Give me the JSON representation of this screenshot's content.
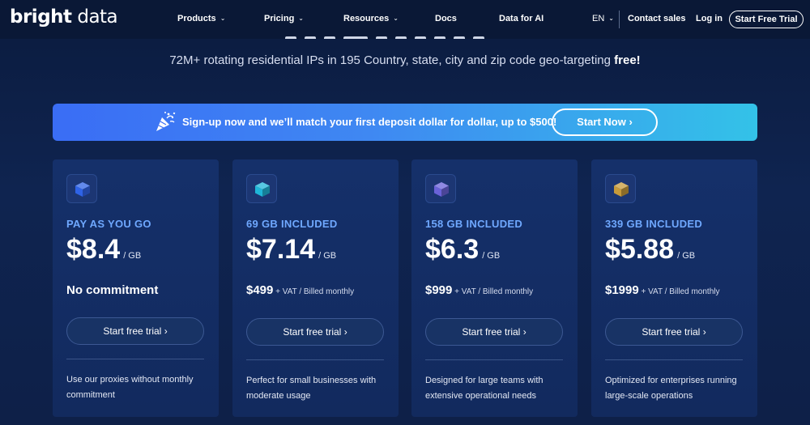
{
  "nav": {
    "logo_bold": "bright",
    "logo_light": " data",
    "items": [
      {
        "label": "Products",
        "has_dropdown": true
      },
      {
        "label": "Pricing",
        "has_dropdown": true
      },
      {
        "label": "Resources",
        "has_dropdown": true
      },
      {
        "label": "Docs",
        "has_dropdown": false
      },
      {
        "label": "Data for AI",
        "has_dropdown": false
      }
    ],
    "language": "EN",
    "contact_sales": "Contact sales",
    "login": "Log in",
    "cta": "Start Free Trial"
  },
  "hero": {
    "subtitle": "72M+ rotating residential IPs in 195 Country, state, city and zip code geo-targeting ",
    "subtitle_bold": "free!"
  },
  "banner": {
    "text": "Sign-up now and we’ll match your first deposit dollar for dollar, up to $500!",
    "button": "Start Now",
    "icon": "party-popper-icon"
  },
  "plans": [
    {
      "name": "PAY AS YOU GO",
      "price": "$8.4",
      "unit": "/ GB",
      "billing_main": "No commitment",
      "billing_suffix": "",
      "button": "Start free trial",
      "description": "Use our proxies without monthly commitment",
      "cube_color": "#2f63e6"
    },
    {
      "name": "69 GB INCLUDED",
      "price": "$7.14",
      "unit": "/ GB",
      "billing_main": "$499",
      "billing_suffix": " + VAT / Billed monthly",
      "button": "Start free trial",
      "description": "Perfect for small businesses with moderate usage",
      "cube_color": "#1fb6d8"
    },
    {
      "name": "158 GB INCLUDED",
      "price": "$6.3",
      "unit": "/ GB",
      "billing_main": "$999",
      "billing_suffix": " + VAT / Billed monthly",
      "button": "Start free trial",
      "description": "Designed for large teams with extensive operational needs",
      "cube_color": "#6a62d8"
    },
    {
      "name": "339 GB INCLUDED",
      "price": "$5.88",
      "unit": "/ GB",
      "billing_main": "$1999",
      "billing_suffix": " + VAT / Billed monthly",
      "button": "Start free trial",
      "description": "Optimized for enterprises running large-scale operations",
      "cube_color": "#c79a3a"
    }
  ],
  "colors": {
    "background": "#0f2450",
    "card": "#14306a",
    "plan_name": "#6fa8ff",
    "banner_start": "#3a6df5",
    "banner_end": "#33c2e8"
  }
}
